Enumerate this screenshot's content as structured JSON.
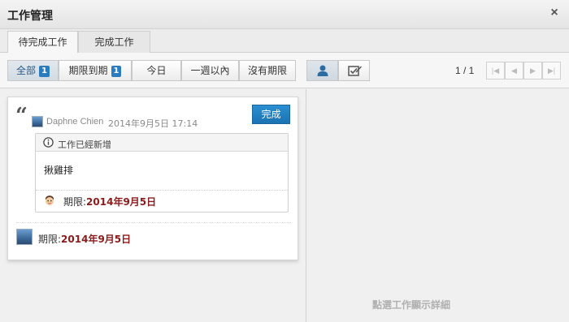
{
  "window": {
    "title": "工作管理",
    "close_label": "×"
  },
  "tabs": [
    {
      "label": "待完成工作",
      "active": true
    },
    {
      "label": "完成工作",
      "active": false
    }
  ],
  "filters": [
    {
      "label": "全部",
      "badge": "1",
      "active": true
    },
    {
      "label": "期限到期",
      "badge": "1",
      "active": false
    },
    {
      "label": "今日",
      "badge": "",
      "active": false
    },
    {
      "label": "一週以內",
      "badge": "",
      "active": false
    },
    {
      "label": "沒有期限",
      "badge": "",
      "active": false
    }
  ],
  "view_buttons": [
    {
      "icon": "user-icon",
      "active": true
    },
    {
      "icon": "task-edit-icon",
      "active": false
    }
  ],
  "pager": {
    "text": "1 / 1",
    "first": "|◀",
    "prev": "◀",
    "next": "▶",
    "last": "▶|"
  },
  "task": {
    "author": "Daphne Chien",
    "created": "2014年9月5日 17:14",
    "done_label": "完成",
    "notice": "工作已經新增",
    "text": "揪雞排",
    "deadline_label": "期限:",
    "deadline_value": "2014年9月5日"
  },
  "footer_deadline": {
    "label": "期限:",
    "value": "2014年9月5日"
  },
  "detail_placeholder": "點選工作顯示詳細",
  "colors": {
    "accent": "#1a73b2",
    "badge": "#2b7cbf",
    "deadline": "#8b1a1a"
  }
}
